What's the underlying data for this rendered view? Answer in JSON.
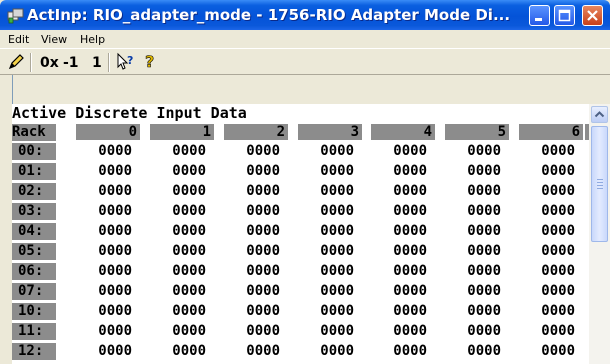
{
  "window": {
    "title": "ActInp: RIO_adapter_mode - 1756-RIO Adapter Mode Di...",
    "buttons": {
      "minimize": "minimize",
      "maximize": "maximize",
      "close": "close"
    }
  },
  "menu": {
    "items": [
      "Edit",
      "View",
      "Help"
    ]
  },
  "toolbar": {
    "format_hex": "0x",
    "minus_one": "-1",
    "one": "1",
    "icons": [
      "pencil-icon",
      "whats-this-help-icon",
      "help-icon"
    ]
  },
  "content": {
    "heading": "Active Discrete Input Data",
    "rack_label": "Rack",
    "columns": [
      "0",
      "1",
      "2",
      "3",
      "4",
      "5",
      "6"
    ],
    "rows": [
      {
        "label": "00:",
        "values": [
          "0000",
          "0000",
          "0000",
          "0000",
          "0000",
          "0000",
          "0000"
        ]
      },
      {
        "label": "01:",
        "values": [
          "0000",
          "0000",
          "0000",
          "0000",
          "0000",
          "0000",
          "0000"
        ]
      },
      {
        "label": "02:",
        "values": [
          "0000",
          "0000",
          "0000",
          "0000",
          "0000",
          "0000",
          "0000"
        ]
      },
      {
        "label": "03:",
        "values": [
          "0000",
          "0000",
          "0000",
          "0000",
          "0000",
          "0000",
          "0000"
        ]
      },
      {
        "label": "04:",
        "values": [
          "0000",
          "0000",
          "0000",
          "0000",
          "0000",
          "0000",
          "0000"
        ]
      },
      {
        "label": "05:",
        "values": [
          "0000",
          "0000",
          "0000",
          "0000",
          "0000",
          "0000",
          "0000"
        ]
      },
      {
        "label": "06:",
        "values": [
          "0000",
          "0000",
          "0000",
          "0000",
          "0000",
          "0000",
          "0000"
        ]
      },
      {
        "label": "07:",
        "values": [
          "0000",
          "0000",
          "0000",
          "0000",
          "0000",
          "0000",
          "0000"
        ]
      },
      {
        "label": "10:",
        "values": [
          "0000",
          "0000",
          "0000",
          "0000",
          "0000",
          "0000",
          "0000"
        ]
      },
      {
        "label": "11:",
        "values": [
          "0000",
          "0000",
          "0000",
          "0000",
          "0000",
          "0000",
          "0000"
        ]
      },
      {
        "label": "12:",
        "values": [
          "0000",
          "0000",
          "0000",
          "0000",
          "0000",
          "0000",
          "0000"
        ]
      }
    ]
  },
  "colors": {
    "title_bar": "#0453d8",
    "header_gray": "#8c8c8c",
    "face": "#ece9d8"
  }
}
